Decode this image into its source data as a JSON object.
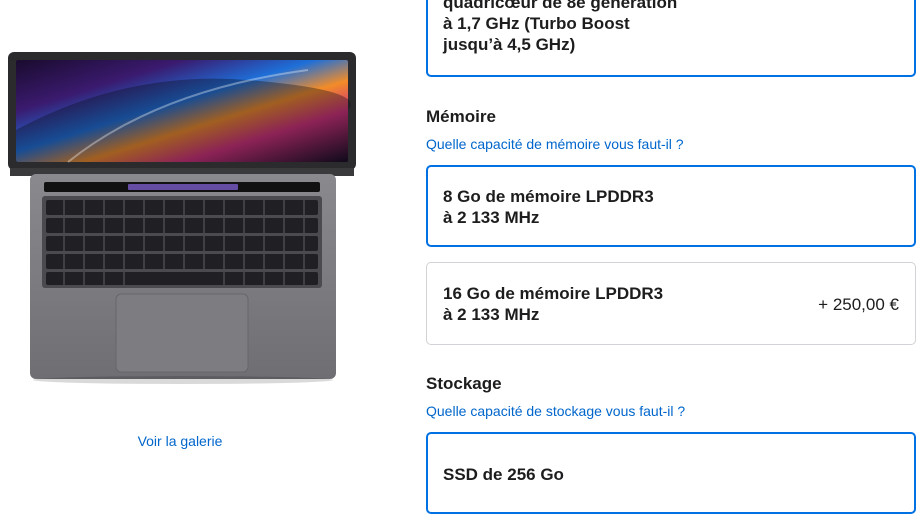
{
  "gallery": {
    "link_label": "Voir la galerie"
  },
  "processor": {
    "selected_option": {
      "label": "quadricœur de 8e génération\nà 1,7 GHz (Turbo Boost\njusqu’à 4,5 GHz)"
    }
  },
  "memory": {
    "title": "Mémoire",
    "help_link": "Quelle capacité de mémoire vous faut-il ?",
    "options": [
      {
        "label": "8 Go de mémoire LPDDR3\nà 2 133 MHz",
        "price": "",
        "selected": true
      },
      {
        "label": "16 Go de mémoire LPDDR3\nà 2 133 MHz",
        "price": "+ 250,00 €",
        "selected": false
      }
    ]
  },
  "storage": {
    "title": "Stockage",
    "help_link": "Quelle capacité de stockage vous faut-il ?",
    "options": [
      {
        "label": "SSD de 256 Go",
        "selected": true
      }
    ]
  },
  "colors": {
    "accent": "#0071e3",
    "link": "#0066cc",
    "border": "#d2d2d7",
    "text": "#1d1d1f"
  }
}
